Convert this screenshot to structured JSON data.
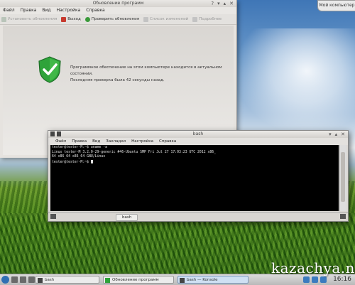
{
  "desktop": {
    "badge": "Мой компьютер",
    "watermark": "kazachya.net"
  },
  "updater": {
    "title": "Обновление программ",
    "menu": [
      "Файл",
      "Правка",
      "Вид",
      "Настройка",
      "Справка"
    ],
    "toolbar": [
      {
        "label": "Установить обновления",
        "enabled": false
      },
      {
        "label": "Выход",
        "enabled": true
      },
      {
        "label": "Проверить обновления",
        "enabled": true
      },
      {
        "label": "Список изменений",
        "enabled": false
      },
      {
        "label": "Подробнее",
        "enabled": false
      }
    ],
    "message_line1": "Программное обеспечение на этом компьютере находится в актуальном состоянии.",
    "message_line2": "Последняя проверка была 42 секунды назад."
  },
  "konsole": {
    "title": "bash",
    "menu": [
      "Файл",
      "Правка",
      "Вид",
      "Закладки",
      "Настройка",
      "Справка"
    ],
    "lines": [
      "tester@tester-M:~$ uname -a",
      "Linux tester-M 3.2.0-29-generic #46-Ubuntu SMP Fri Jul 27 17:03:23 UTC 2012 x86_",
      "64 x86_64 x86_64 GNU/Linux",
      "tester@tester-M:~$ "
    ],
    "tab_label": "bash"
  },
  "taskbar": {
    "tasks": [
      {
        "label": "bash",
        "active": false
      },
      {
        "label": "Обновление программ",
        "active": false
      },
      {
        "label": "bash — Konsole",
        "active": true
      }
    ],
    "clock": "16:16"
  },
  "colors": {
    "shield": "#2fa33a",
    "terminal_bg": "#000000",
    "accent": "#2f6fb3"
  }
}
